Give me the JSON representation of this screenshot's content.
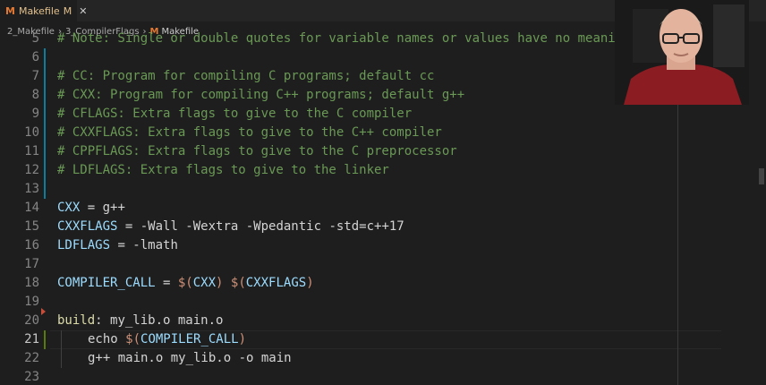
{
  "tab": {
    "icon": "M",
    "label": "Makefile",
    "modified": "M",
    "close": "✕"
  },
  "breadcrumb": {
    "parts": [
      "2_Makefile",
      "3_CompilerFlags"
    ],
    "file_icon": "M",
    "file": "Makefile"
  },
  "lines": [
    {
      "num": "5",
      "text": "# Note: Single or double quotes for variable names or values have no meaning"
    },
    {
      "num": "6",
      "text": ""
    },
    {
      "num": "7",
      "text": "# CC: Program for compiling C programs; default cc"
    },
    {
      "num": "8",
      "text": "# CXX: Program for compiling C++ programs; default g++"
    },
    {
      "num": "9",
      "text": "# CFLAGS: Extra flags to give to the C compiler"
    },
    {
      "num": "10",
      "text": "# CXXFLAGS: Extra flags to give to the C++ compiler"
    },
    {
      "num": "11",
      "text": "# CPPFLAGS: Extra flags to give to the C preprocessor"
    },
    {
      "num": "12",
      "text": "# LDFLAGS: Extra flags to give to the linker"
    },
    {
      "num": "13",
      "text": ""
    },
    {
      "num": "14",
      "a": "CXX",
      "b": " = g++"
    },
    {
      "num": "15",
      "a": "CXXFLAGS",
      "b": " = -Wall -Wextra -Wpedantic -std=c++17"
    },
    {
      "num": "16",
      "a": "LDFLAGS",
      "b": " = -lmath"
    },
    {
      "num": "17",
      "text": ""
    },
    {
      "num": "18",
      "a": "COMPILER_CALL",
      "b": " = ",
      "c": "$(",
      "d": "CXX",
      "e": ") ",
      "f": "$(",
      "g": "CXXFLAGS",
      "h": ")"
    },
    {
      "num": "19",
      "text": ""
    },
    {
      "num": "20",
      "a": "build",
      "b": ": my_lib.o main.o"
    },
    {
      "num": "21",
      "a": "echo ",
      "b": "$(",
      "c": "COMPILER_CALL",
      "d": ")"
    },
    {
      "num": "22",
      "text": "g++ main.o my_lib.o -o main"
    },
    {
      "num": "23",
      "text": ""
    }
  ],
  "colors": {
    "comment": "#6a9955",
    "variable": "#9cdcfe",
    "function": "#dcdcaa",
    "text": "#d4d4d4",
    "background": "#1e1e1e"
  }
}
